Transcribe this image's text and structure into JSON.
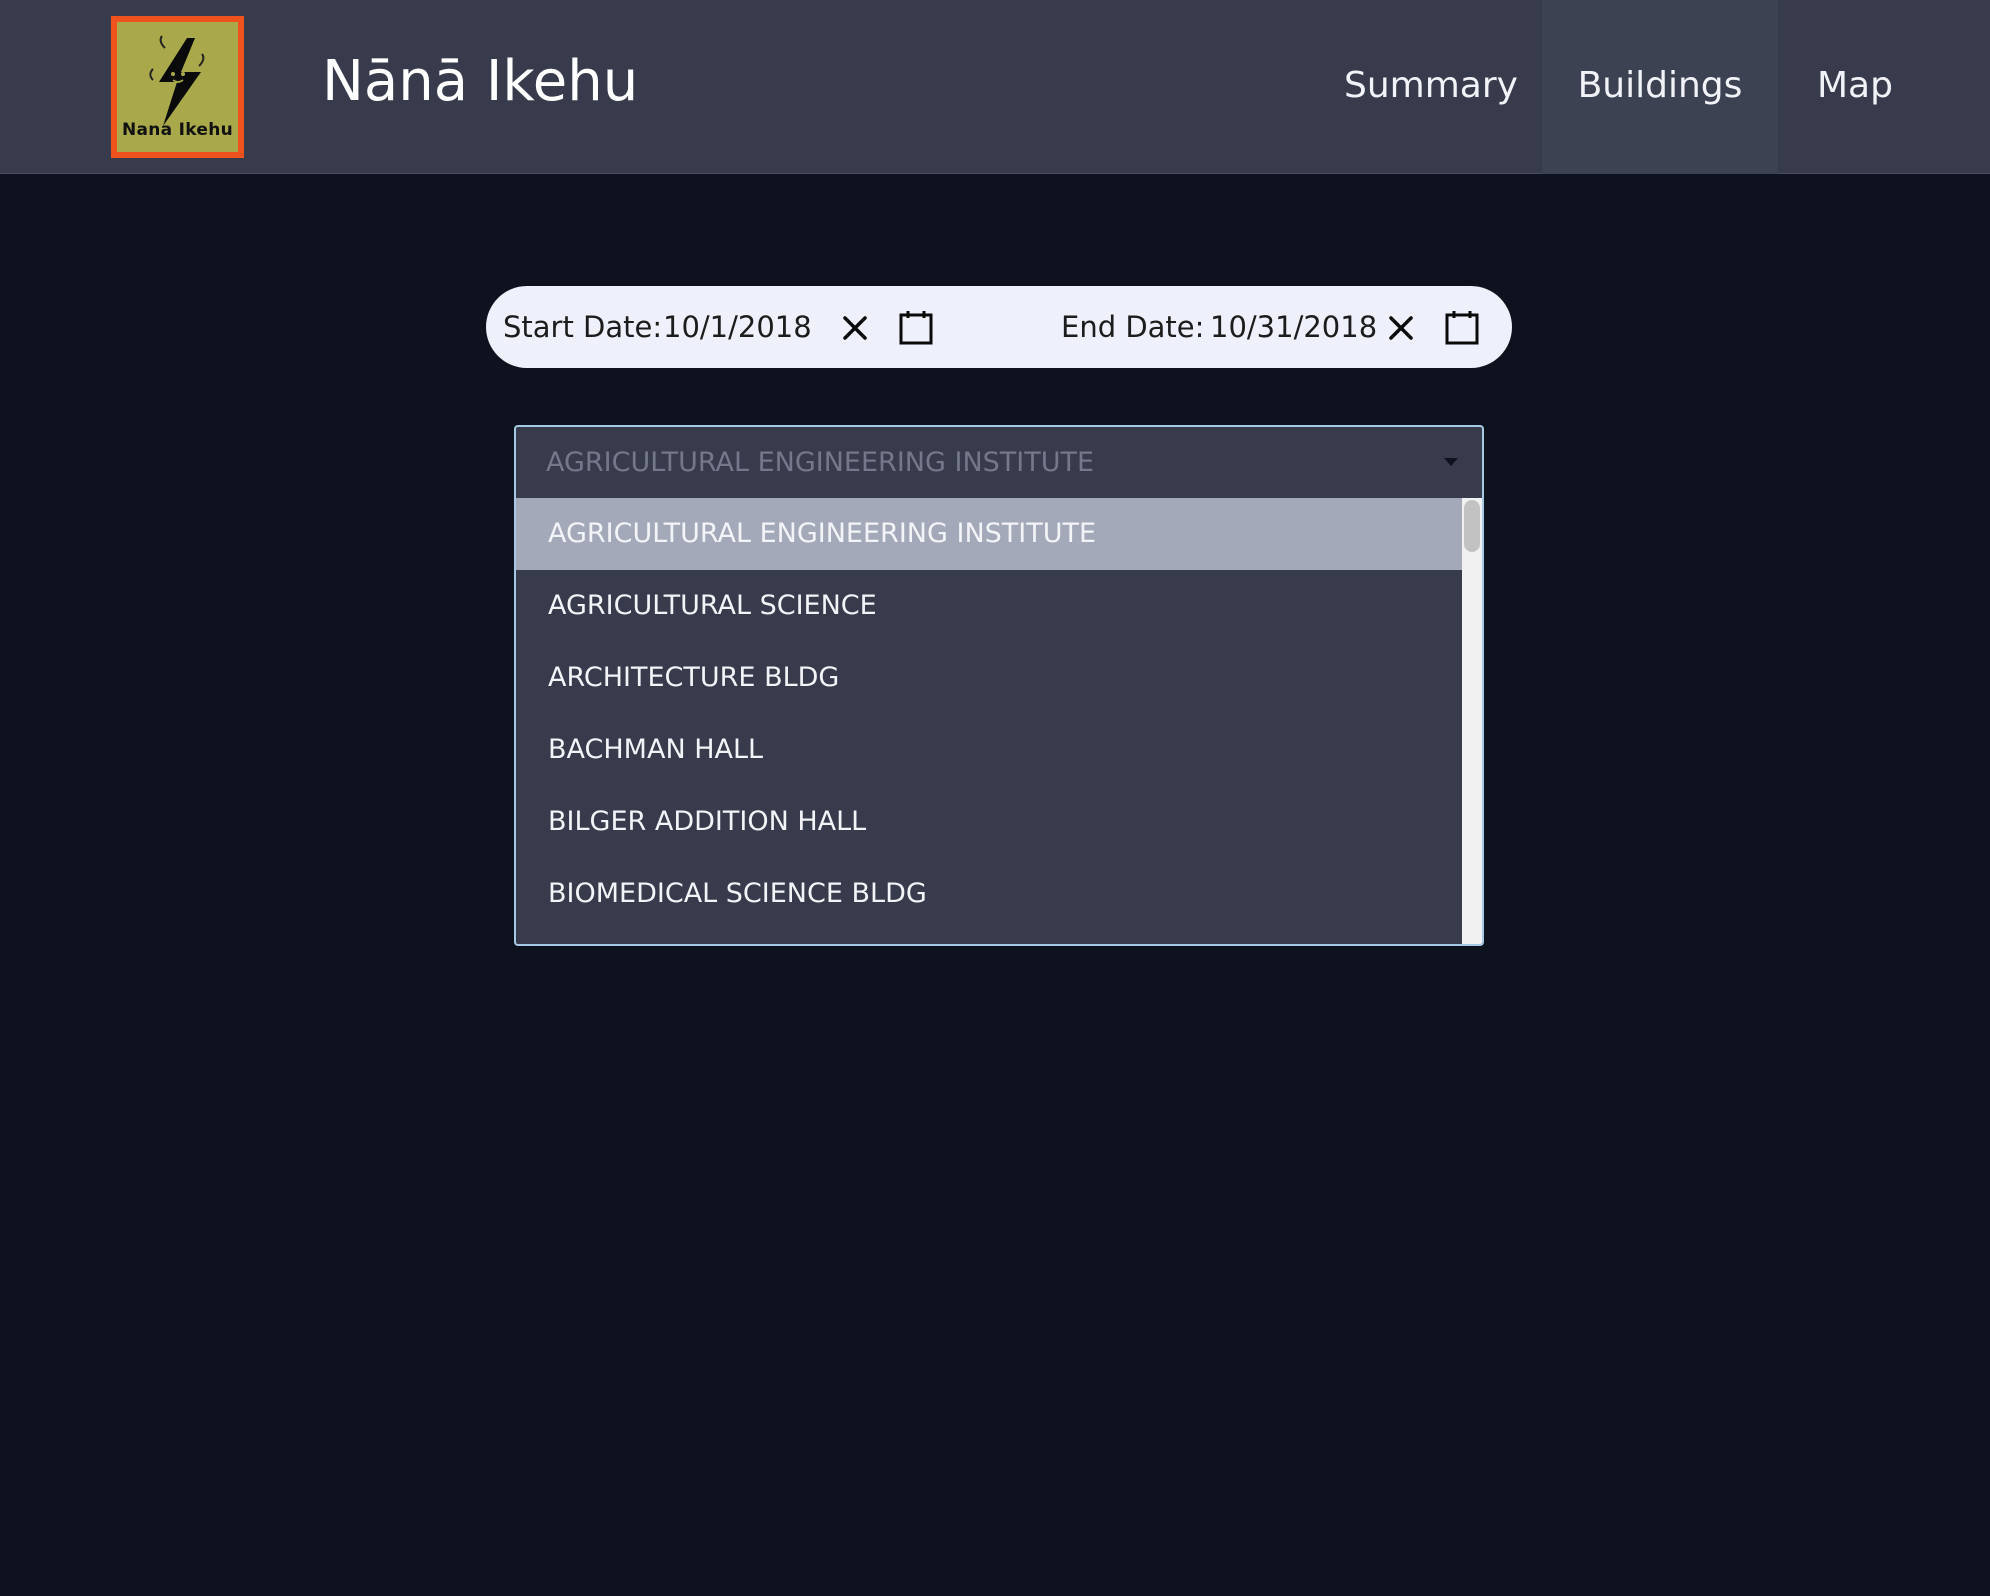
{
  "app": {
    "brand": "Nānā Ikehu",
    "logo_text": "Nana Ikehu"
  },
  "nav": {
    "items": [
      {
        "label": "Summary",
        "active": false
      },
      {
        "label": "Buildings",
        "active": true
      },
      {
        "label": "Map",
        "active": false
      }
    ]
  },
  "date_range": {
    "start_label": "Start Date:",
    "start_value": "10/1/2018",
    "end_label": "End Date:",
    "end_value": "10/31/2018",
    "clear_icon": "close-icon",
    "calendar_icon": "calendar-icon"
  },
  "building_select": {
    "selected_value": "AGRICULTURAL ENGINEERING INSTITUTE",
    "options": [
      "AGRICULTURAL ENGINEERING INSTITUTE",
      "AGRICULTURAL SCIENCE",
      "ARCHITECTURE BLDG",
      "BACHMAN HALL",
      "BILGER ADDITION HALL",
      "BIOMEDICAL SCIENCE BLDG"
    ],
    "highlighted_index": 0
  },
  "colors": {
    "page_bg": "#0d121e",
    "navbar_bg": "#373b4b",
    "pill_bg": "#eef0fb",
    "select_border": "#a5cbe4",
    "option_highlight": "#a4a9b9",
    "logo_border": "#f0521e",
    "logo_fill": "#a9a94b"
  }
}
